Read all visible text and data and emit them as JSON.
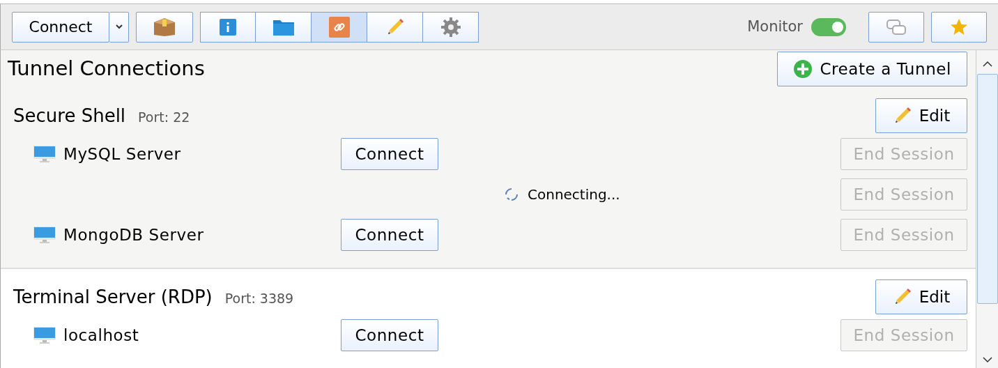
{
  "toolbar": {
    "connect_button": "Connect",
    "view_tabs": [
      {
        "kind": "info",
        "selected": false
      },
      {
        "kind": "folder",
        "selected": false
      },
      {
        "kind": "link",
        "selected": true
      },
      {
        "kind": "pencil",
        "selected": false
      },
      {
        "kind": "gear",
        "selected": false
      }
    ],
    "monitor": {
      "label": "Monitor",
      "on": true
    }
  },
  "page": {
    "title": "Tunnel Connections",
    "create_button": "Create a Tunnel"
  },
  "sections": [
    {
      "name": "Secure Shell",
      "port": "Port: 22",
      "edit_button": "Edit",
      "items": [
        {
          "kind": "host",
          "name": "MySQL Server",
          "connect_button": "Connect",
          "end_button": "End Session",
          "disabled": true
        },
        {
          "kind": "session",
          "status": "Connecting...",
          "end_button": "End Session",
          "disabled": true
        },
        {
          "kind": "host",
          "name": "MongoDB Server",
          "connect_button": "Connect",
          "end_button": "End Session",
          "disabled": true
        }
      ]
    },
    {
      "name": "Terminal Server (RDP)",
      "port": "Port: 3389",
      "edit_button": "Edit",
      "items": [
        {
          "kind": "host",
          "name": "localhost",
          "connect_button": "Connect",
          "end_button": "End Session",
          "disabled": true
        }
      ]
    }
  ]
}
